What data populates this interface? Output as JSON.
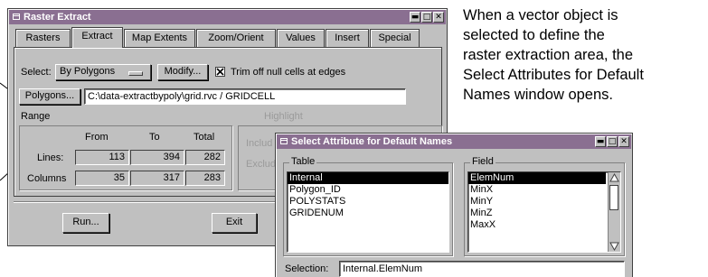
{
  "explanation_lines": [
    "When a vector object is",
    "selected to define the",
    "raster extraction area, the",
    "Select Attributes for Default",
    "Names window opens."
  ],
  "raster_window": {
    "title": "Raster Extract",
    "title_buttons": [
      "▬",
      "□",
      "✕"
    ],
    "tabs": [
      "Rasters",
      "Extract",
      "Map Extents",
      "Zoom/Orient",
      "Values",
      "Insert",
      "Special"
    ],
    "active_tab": "Extract",
    "select_label": "Select:",
    "select_value": "By Polygons",
    "modify_label": "Modify...",
    "trim_checkbox_label": "Trim off null cells at edges",
    "trim_checked": true,
    "polygons_label": "Polygons...",
    "polygons_path": "C:\\data-extractbypoly\\grid.rvc / GRIDCELL",
    "range_label": "Range",
    "range_headers": [
      "From",
      "To",
      "Total"
    ],
    "range_rows": [
      {
        "label": "Lines:",
        "from": "113",
        "to": "394",
        "total": "282"
      },
      {
        "label": "Columns",
        "from": "35",
        "to": "317",
        "total": "283"
      }
    ],
    "highlight_label": "Highlight",
    "include_label": "Includ",
    "exclude_label": "Exclud",
    "run_label": "Run...",
    "exit_label": "Exit"
  },
  "attr_window": {
    "title": "Select Attribute for Default Names",
    "title_buttons": [
      "▬",
      "□",
      "✕"
    ],
    "table_label": "Table",
    "table_items": [
      "Internal",
      "Polygon_ID",
      "POLYSTATS",
      "GRIDENUM"
    ],
    "table_selected": 0,
    "field_label": "Field",
    "field_items": [
      "ElemNum",
      "MinX",
      "MinY",
      "MinZ",
      "MaxX"
    ],
    "field_selected": 0,
    "selection_label": "Selection:",
    "selection_value": "Internal.ElemNum"
  },
  "colors": {
    "titlebar": "#8a6f91",
    "window_face": "#c0c0c0"
  }
}
